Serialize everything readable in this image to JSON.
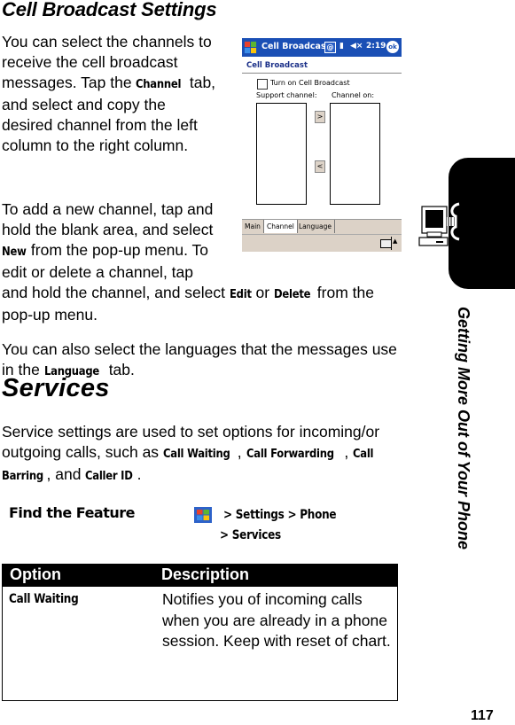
{
  "section1": {
    "heading": "Cell Broadcast Settings",
    "para1_lines": [
      "You can select the channels to",
      "receive the cell broadcast"
    ],
    "para1_l3_pre": "messages. Tap the ",
    "para1_l3_kw": "Channel",
    "para1_l3_post": " tab,",
    "para1_rest": [
      "and select and copy the",
      "desired channel from the left",
      "column to the right column."
    ],
    "para2_lines": [
      "To add a new channel, tap and",
      "hold the blank area, and select"
    ],
    "para2_l3_kw": "New",
    "para2_l3_post": " from the pop-up menu. To",
    "para2_l4": "edit or delete a channel, tap",
    "para2_l5_pre": "and hold the channel, and select ",
    "para2_l5_kw1": "Edit",
    "para2_l5_mid": " or ",
    "para2_l5_kw2": "Delete",
    "para2_l5_post": " from the",
    "para2_l6": "pop-up menu.",
    "para3_l1": "You can also select the languages that the messages use",
    "para3_l2_pre": "in the ",
    "para3_l2_kw": "Language",
    "para3_l2_post": " tab."
  },
  "screenshot": {
    "title": "Cell Broadcast",
    "status_icons": [
      "network-icon",
      "signal-icon",
      "volume-muted-icon"
    ],
    "time": "2:19",
    "ok_label": "ok",
    "subheader": "Cell Broadcast",
    "checkbox_label": "Turn on Cell Broadcast",
    "checkbox_checked": false,
    "support_channel_label": "Support channel:",
    "channel_on_label": "Channel on:",
    "add_button": ">",
    "remove_button": "<",
    "tabs": [
      {
        "label": "Main",
        "active": false
      },
      {
        "label": "Channel",
        "active": true
      },
      {
        "label": "Language",
        "active": false
      }
    ],
    "keyboard_arrow": "▲"
  },
  "sidebar": {
    "section_title": "Getting More Out of Your Phone",
    "icon": "computer-phone-icon"
  },
  "section2": {
    "heading": "Services",
    "l1": "Service settings are used to set options for incoming/or",
    "l2_pre": "outgoing calls, such as ",
    "kw1": "Call Waiting",
    "sep1": ", ",
    "kw2": "Call Forwarding",
    "sep2": ", ",
    "kw3a": "Call",
    "kw3b": "Barring",
    "l3_mid": ", and ",
    "kw4": "Caller ID",
    "l3_end": "."
  },
  "find_feature": {
    "label": "Find the Feature",
    "path1": "> Settings > Phone",
    "path2": "> Services",
    "start_icon": "windows-start-icon"
  },
  "table": {
    "headers": [
      "Option",
      "Description"
    ],
    "rows": [
      {
        "option": "Call Waiting",
        "description": "Notifies you of incoming calls when you are already in a phone session. Keep with reset of chart."
      }
    ]
  },
  "page_number": "117"
}
